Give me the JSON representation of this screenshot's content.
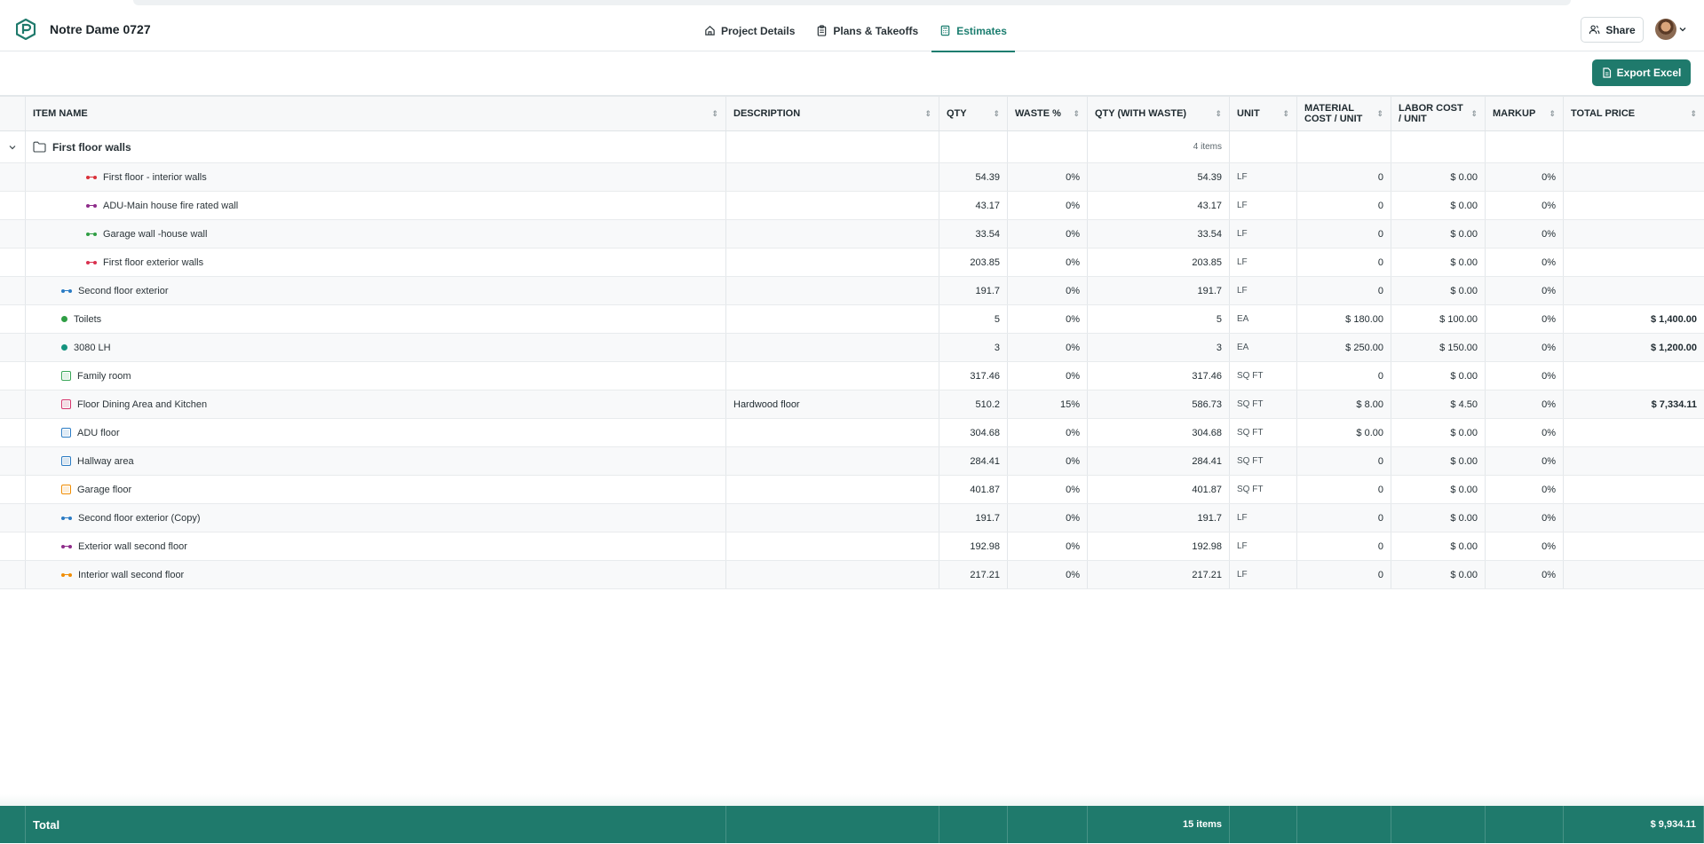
{
  "project": {
    "title": "Notre Dame 0727"
  },
  "tabs": [
    {
      "label": "Project Details",
      "icon": "home-icon"
    },
    {
      "label": "Plans & Takeoffs",
      "icon": "clipboard-icon"
    },
    {
      "label": "Estimates",
      "icon": "calculator-icon",
      "active": true
    }
  ],
  "header": {
    "share_label": "Share"
  },
  "toolbar": {
    "export_label": "Export Excel"
  },
  "columns": [
    "ITEM NAME",
    "DESCRIPTION",
    "QTY",
    "WASTE %",
    "QTY (WITH WASTE)",
    "UNIT",
    "MATERIAL COST / UNIT",
    "LABOR COST / UNIT",
    "MARKUP",
    "TOTAL PRICE"
  ],
  "group": {
    "name": "First floor walls",
    "count": "4 items"
  },
  "rows": [
    {
      "name": "First floor - interior walls",
      "icon": "line",
      "color": "#d9313a",
      "level": 2,
      "description": "",
      "qty": "54.39",
      "waste": "0%",
      "qty_waste": "54.39",
      "unit": "LF",
      "material": "0",
      "labor": "$ 0.00",
      "markup": "0%",
      "total": ""
    },
    {
      "name": "ADU-Main house fire rated wall",
      "icon": "line",
      "color": "#8e2c8a",
      "level": 2,
      "description": "",
      "qty": "43.17",
      "waste": "0%",
      "qty_waste": "43.17",
      "unit": "LF",
      "material": "0",
      "labor": "$ 0.00",
      "markup": "0%",
      "total": ""
    },
    {
      "name": "Garage wall -house wall",
      "icon": "line",
      "color": "#2f9e44",
      "level": 2,
      "description": "",
      "qty": "33.54",
      "waste": "0%",
      "qty_waste": "33.54",
      "unit": "LF",
      "material": "0",
      "labor": "$ 0.00",
      "markup": "0%",
      "total": ""
    },
    {
      "name": "First floor exterior walls",
      "icon": "line",
      "color": "#d9314f",
      "level": 2,
      "description": "",
      "qty": "203.85",
      "waste": "0%",
      "qty_waste": "203.85",
      "unit": "LF",
      "material": "0",
      "labor": "$ 0.00",
      "markup": "0%",
      "total": ""
    },
    {
      "name": "Second floor exterior",
      "icon": "line",
      "color": "#2a7bc4",
      "level": 1,
      "description": "",
      "qty": "191.7",
      "waste": "0%",
      "qty_waste": "191.7",
      "unit": "LF",
      "material": "0",
      "labor": "$ 0.00",
      "markup": "0%",
      "total": ""
    },
    {
      "name": "Toilets",
      "icon": "dot",
      "color": "#2f9e44",
      "level": 1,
      "description": "",
      "qty": "5",
      "waste": "0%",
      "qty_waste": "5",
      "unit": "EA",
      "material": "$ 180.00",
      "labor": "$ 100.00",
      "markup": "0%",
      "total": "$ 1,400.00"
    },
    {
      "name": "3080 LH",
      "icon": "dot",
      "color": "#14937e",
      "level": 1,
      "description": "",
      "qty": "3",
      "waste": "0%",
      "qty_waste": "3",
      "unit": "EA",
      "material": "$ 250.00",
      "labor": "$ 150.00",
      "markup": "0%",
      "total": "$ 1,200.00"
    },
    {
      "name": "Family room",
      "icon": "area",
      "color": "#37a556",
      "level": 1,
      "description": "",
      "qty": "317.46",
      "waste": "0%",
      "qty_waste": "317.46",
      "unit": "SQ FT",
      "material": "0",
      "labor": "$ 0.00",
      "markup": "0%",
      "total": ""
    },
    {
      "name": "Floor Dining Area and Kitchen",
      "icon": "area",
      "color": "#d6336c",
      "level": 1,
      "description": "Hardwood floor",
      "qty": "510.2",
      "waste": "15%",
      "qty_waste": "586.73",
      "unit": "SQ FT",
      "material": "$ 8.00",
      "labor": "$ 4.50",
      "markup": "0%",
      "total": "$ 7,334.11"
    },
    {
      "name": "ADU floor",
      "icon": "area",
      "color": "#2a7bc4",
      "level": 1,
      "description": "",
      "qty": "304.68",
      "waste": "0%",
      "qty_waste": "304.68",
      "unit": "SQ FT",
      "material": "$ 0.00",
      "labor": "$ 0.00",
      "markup": "0%",
      "total": ""
    },
    {
      "name": "Hallway area",
      "icon": "area",
      "color": "#2a7bc4",
      "level": 1,
      "description": "",
      "qty": "284.41",
      "waste": "0%",
      "qty_waste": "284.41",
      "unit": "SQ FT",
      "material": "0",
      "labor": "$ 0.00",
      "markup": "0%",
      "total": ""
    },
    {
      "name": "Garage floor",
      "icon": "area",
      "color": "#f08c00",
      "level": 1,
      "description": "",
      "qty": "401.87",
      "waste": "0%",
      "qty_waste": "401.87",
      "unit": "SQ FT",
      "material": "0",
      "labor": "$ 0.00",
      "markup": "0%",
      "total": ""
    },
    {
      "name": "Second floor exterior (Copy)",
      "icon": "line",
      "color": "#2a7bc4",
      "level": 1,
      "description": "",
      "qty": "191.7",
      "waste": "0%",
      "qty_waste": "191.7",
      "unit": "LF",
      "material": "0",
      "labor": "$ 0.00",
      "markup": "0%",
      "total": ""
    },
    {
      "name": "Exterior wall second floor",
      "icon": "line",
      "color": "#8e2c8a",
      "level": 1,
      "description": "",
      "qty": "192.98",
      "waste": "0%",
      "qty_waste": "192.98",
      "unit": "LF",
      "material": "0",
      "labor": "$ 0.00",
      "markup": "0%",
      "total": ""
    },
    {
      "name": "Interior wall second floor",
      "icon": "line",
      "color": "#f08c00",
      "level": 1,
      "description": "",
      "qty": "217.21",
      "waste": "0%",
      "qty_waste": "217.21",
      "unit": "LF",
      "material": "0",
      "labor": "$ 0.00",
      "markup": "0%",
      "total": ""
    }
  ],
  "footer": {
    "label": "Total",
    "count": "15 items",
    "total": "$ 9,934.11"
  },
  "colors": {
    "accent": "#1f7a6c",
    "active_tab": "#1b7d6f"
  }
}
